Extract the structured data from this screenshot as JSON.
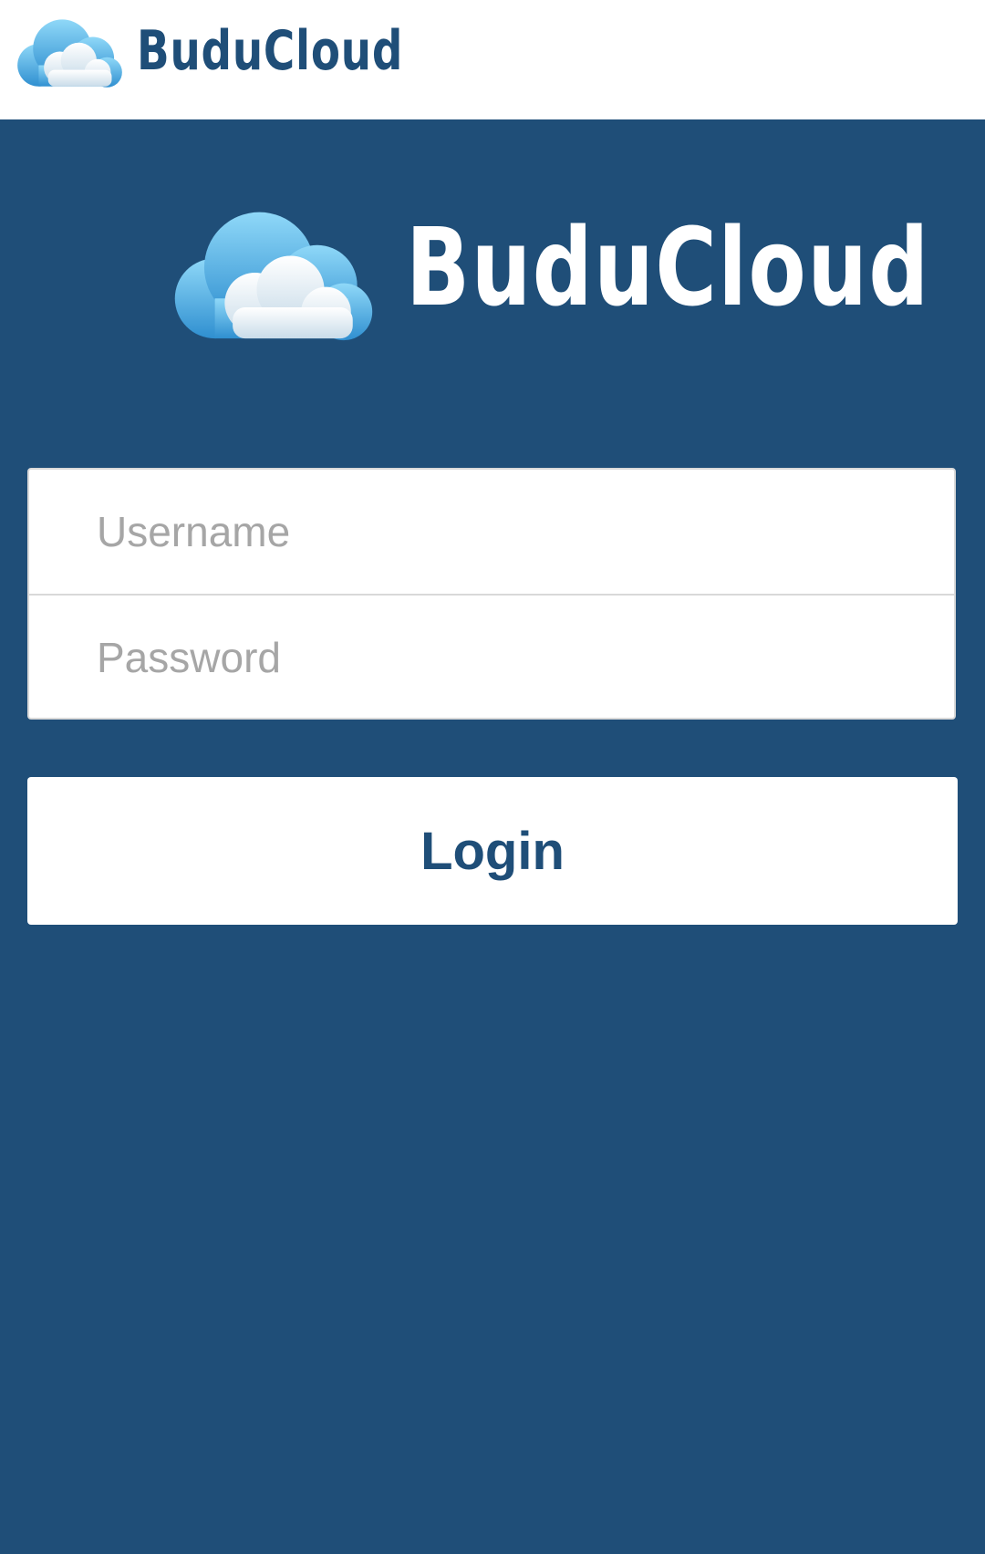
{
  "header": {
    "brand": "BuduCloud",
    "logo_icon": "cloud-icon"
  },
  "hero": {
    "brand": "BuduCloud",
    "logo_icon": "cloud-icon"
  },
  "form": {
    "username_placeholder": "Username",
    "username_value": "",
    "password_placeholder": "Password",
    "password_value": "",
    "login_label": "Login"
  },
  "colors": {
    "brand_blue": "#1f4e78",
    "white": "#ffffff",
    "placeholder_gray": "#a6a6a6",
    "border_gray": "#d9d9d9"
  }
}
